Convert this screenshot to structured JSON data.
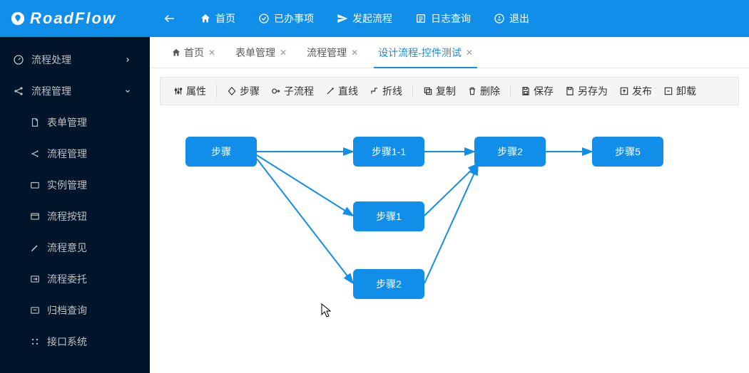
{
  "brand": "RoadFlow",
  "topnav": {
    "home": "首页",
    "done": "已办事项",
    "start": "发起流程",
    "logs": "日志查询",
    "logout": "退出"
  },
  "sidebar": {
    "section_process": "流程处理",
    "section_mgmt": "流程管理",
    "items": [
      "表单管理",
      "流程管理",
      "实例管理",
      "流程按钮",
      "流程意见",
      "流程委托",
      "归档查询",
      "接口系统"
    ]
  },
  "tabs": [
    {
      "label": "首页",
      "icon": "home",
      "closable": true
    },
    {
      "label": "表单管理",
      "closable": true
    },
    {
      "label": "流程管理",
      "closable": true
    },
    {
      "label": "设计流程-控件测试",
      "closable": true,
      "active": true
    }
  ],
  "toolbar": {
    "props": "属性",
    "step": "步骤",
    "subflow": "子流程",
    "line": "直线",
    "polyline": "折线",
    "copy": "复制",
    "delete": "删除",
    "save": "保存",
    "saveas": "另存为",
    "publish": "发布",
    "uninstall": "卸载"
  },
  "nodes": {
    "n1": "步骤",
    "n2": "步骤1-1",
    "n3": "步骤2",
    "n4": "步骤5",
    "n5": "步骤1",
    "n6": "步骤2"
  },
  "colors": {
    "primary": "#108ee9",
    "sidebar_bg": "#001529"
  }
}
